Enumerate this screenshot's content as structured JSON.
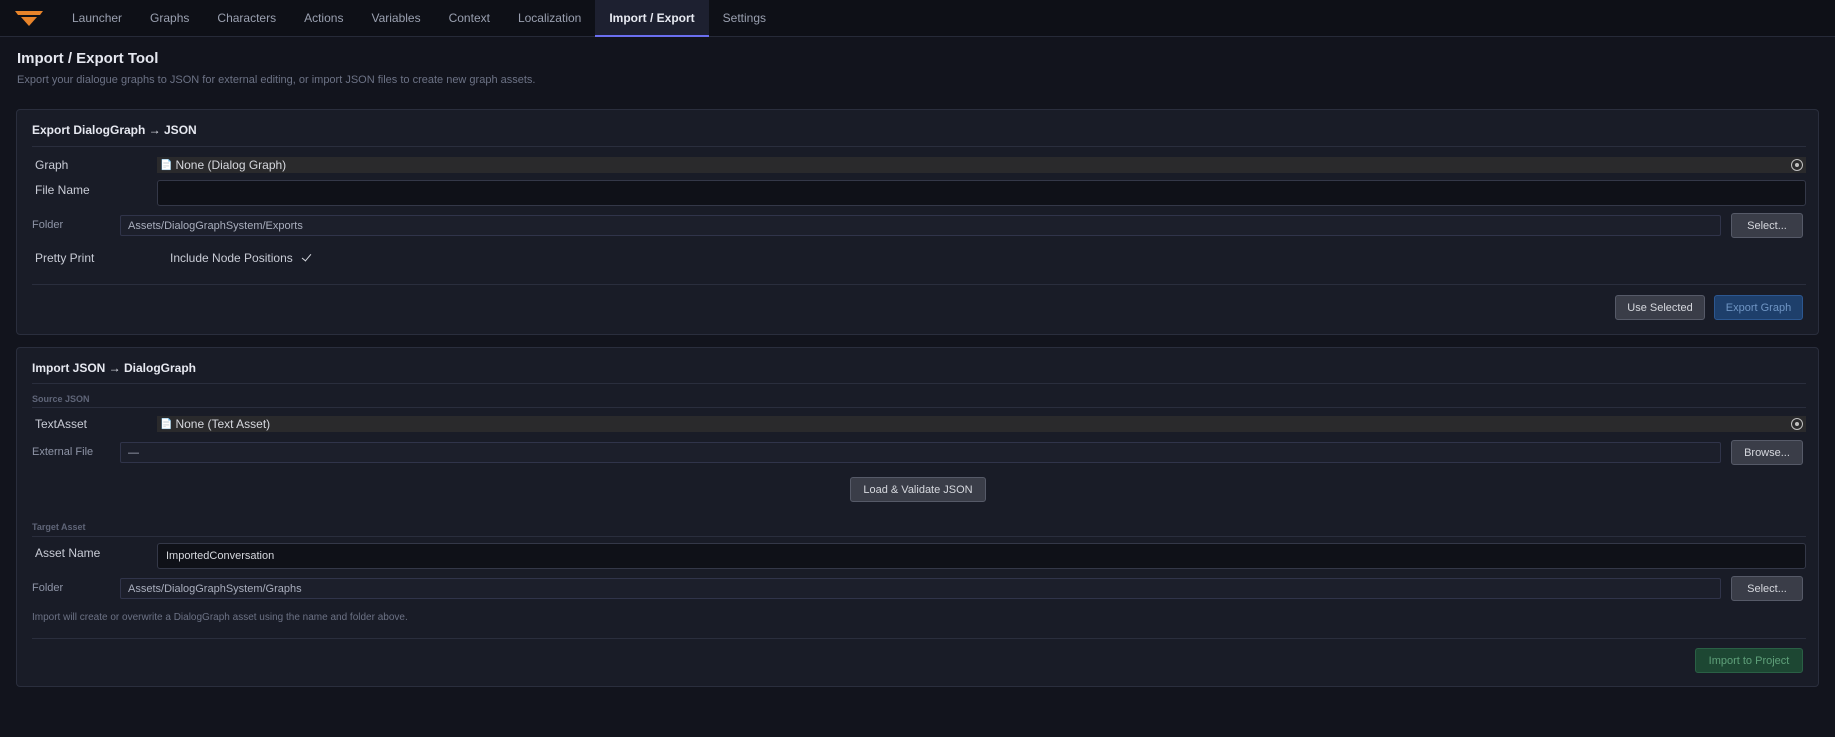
{
  "nav": {
    "tabs": [
      {
        "label": "Launcher"
      },
      {
        "label": "Graphs"
      },
      {
        "label": "Characters"
      },
      {
        "label": "Actions"
      },
      {
        "label": "Variables"
      },
      {
        "label": "Context"
      },
      {
        "label": "Localization"
      },
      {
        "label": "Import / Export",
        "active": true
      },
      {
        "label": "Settings"
      }
    ],
    "accent_color": "#6b6ff0"
  },
  "page": {
    "title": "Import / Export Tool",
    "subtitle": "Export your dialogue graphs to JSON for external editing, or import JSON files to create new graph assets."
  },
  "export": {
    "title": "Export  DialogGraph → JSON",
    "graph_label": "Graph",
    "graph_value": "None (Dialog Graph)",
    "file_name_label": "File Name",
    "file_name_value": "",
    "folder_label": "Folder",
    "folder_value": "Assets/DialogGraphSystem/Exports",
    "select_button": "Select...",
    "pretty_print_label": "Pretty Print",
    "include_positions_label": "Include Node Positions",
    "use_selected_button": "Use Selected",
    "export_button": "Export Graph"
  },
  "import": {
    "title": "Import JSON → DialogGraph",
    "source_section": "Source JSON",
    "textasset_label": "TextAsset",
    "textasset_value": "None (Text Asset)",
    "external_file_label": "External File",
    "external_file_value": "—",
    "browse_button": "Browse...",
    "load_button": "Load & Validate JSON",
    "target_section": "Target Asset",
    "asset_name_label": "Asset Name",
    "asset_name_value": "ImportedConversation",
    "folder_label": "Folder",
    "folder_value": "Assets/DialogGraphSystem/Graphs",
    "select_button": "Select...",
    "note": "Import will create or overwrite a DialogGraph asset using the name and folder above.",
    "import_button": "Import to Project"
  }
}
